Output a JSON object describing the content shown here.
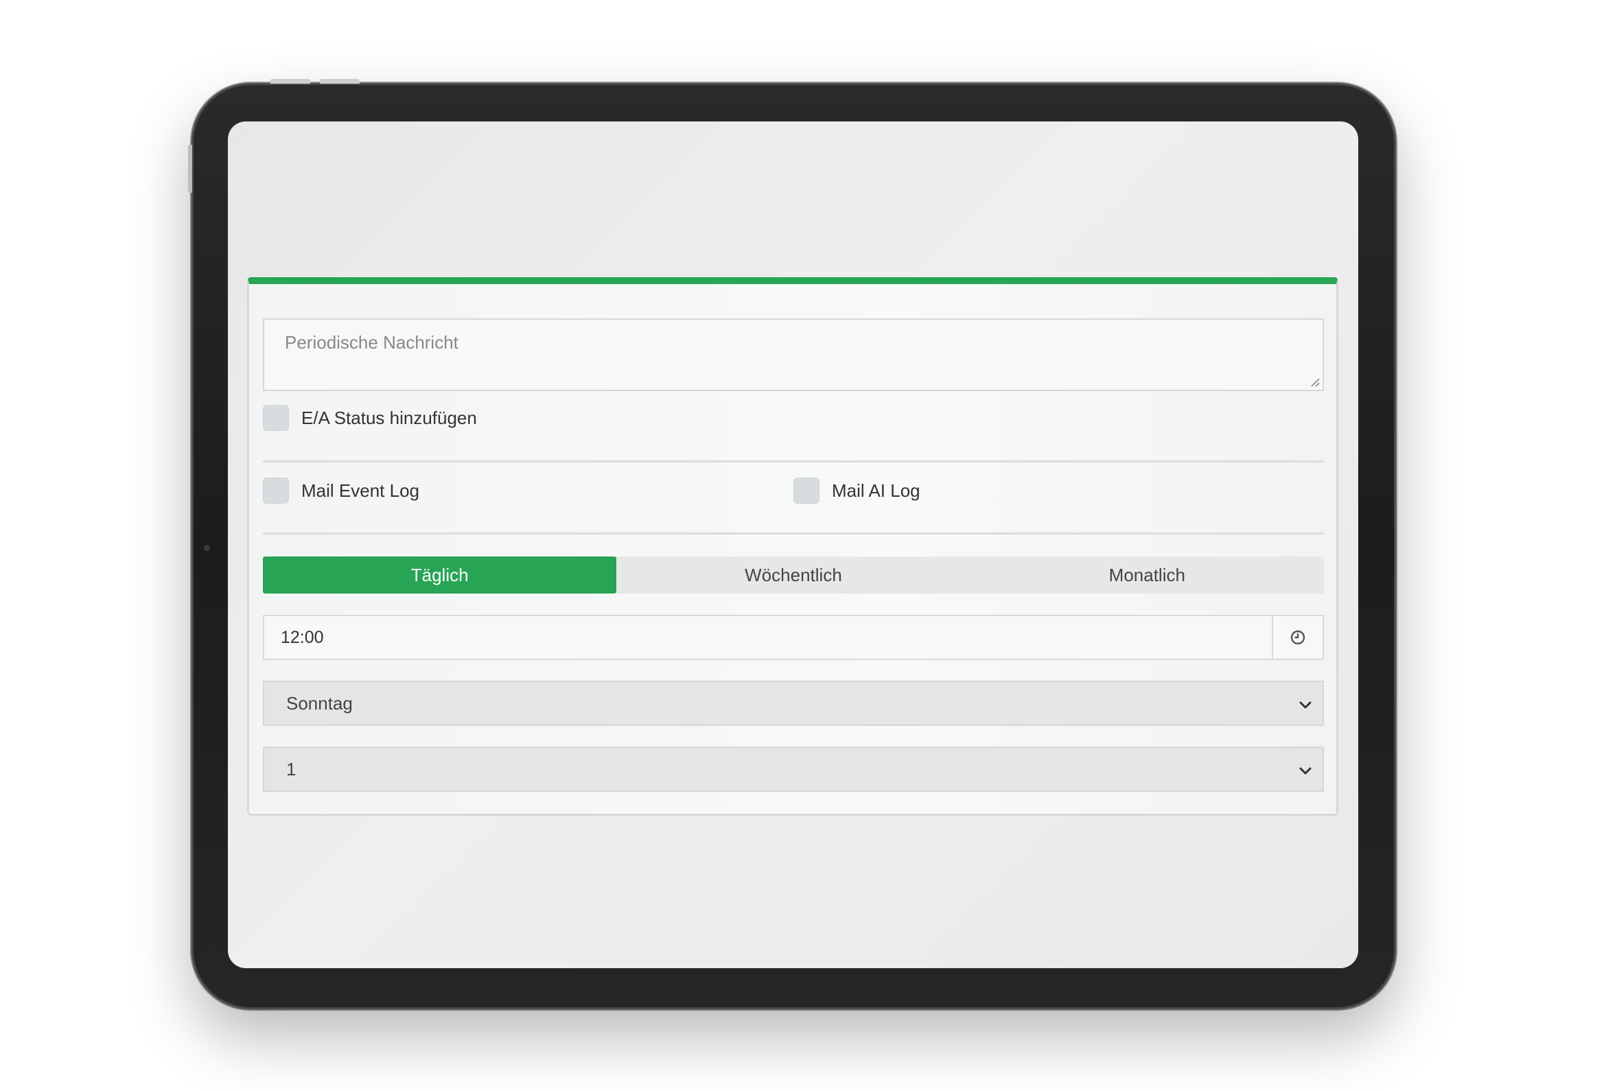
{
  "form": {
    "message_placeholder": "Periodische Nachricht",
    "io_status_label": "E/A Status hinzufügen",
    "mail_event_log_label": "Mail Event Log",
    "mail_ai_log_label": "Mail AI Log",
    "tabs": [
      {
        "label": "Täglich",
        "active": true
      },
      {
        "label": "Wöchentlich",
        "active": false
      },
      {
        "label": "Monatlich",
        "active": false
      }
    ],
    "time_value": "12:00",
    "weekday_select_value": "Sonntag",
    "day_of_month_select_value": "1"
  },
  "colors": {
    "accent": "#27a454",
    "bezel": "#1f1f1f",
    "screen_bg": "#ececec"
  },
  "icons": {
    "clock": "clock-icon",
    "chevron": "chevron-down-icon"
  }
}
